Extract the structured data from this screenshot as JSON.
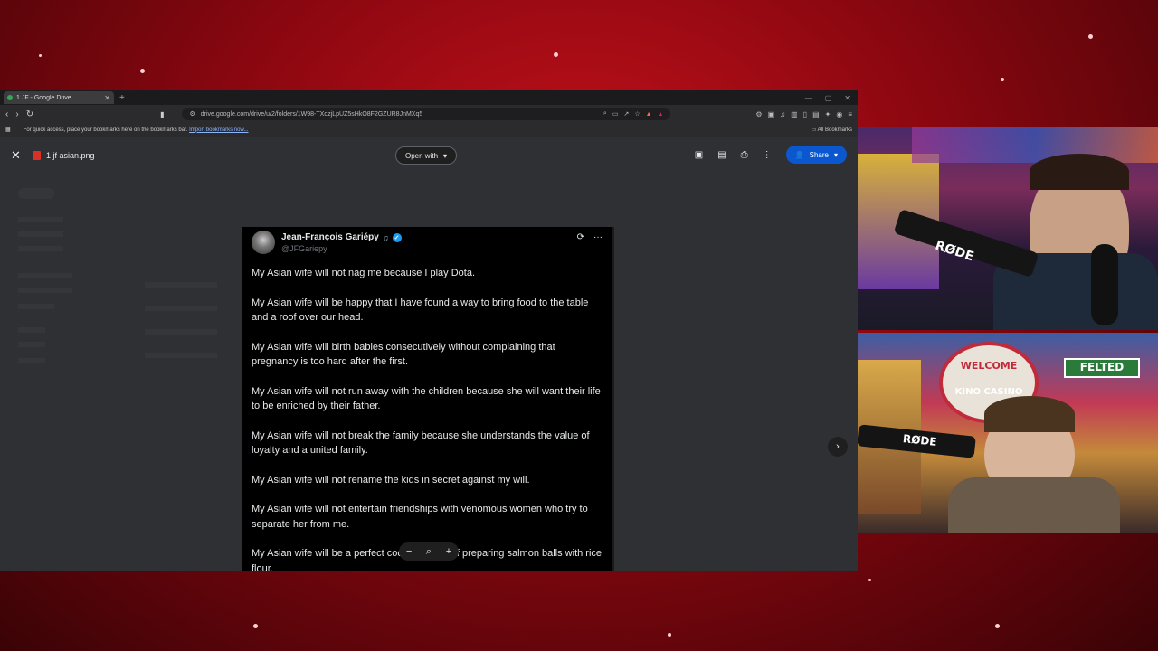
{
  "browser": {
    "tab_title": "1 JF - Google Drive",
    "url": "drive.google.com/drive/u/2/folders/1W98-TXqzjLpUZ5sHkO8F2GZUR8JnMXq5",
    "bookmarks_hint": "For quick access, place your bookmarks here on the bookmarks bar.",
    "import_bookmarks_link": "Import bookmarks now...",
    "all_bookmarks": "All Bookmarks"
  },
  "viewer": {
    "file_name": "1 jf asian.png",
    "open_with_label": "Open with",
    "share_label": "Share",
    "zoom_out": "−",
    "zoom_icon": "⌕",
    "zoom_in": "+"
  },
  "tweet": {
    "author_name": "Jean-François Gariépy",
    "handle": "@JFGariepy",
    "paragraphs": [
      "My Asian wife will not nag me because I play Dota.",
      "My Asian wife will be happy that I have found a way to bring food to the table and a roof over our head.",
      "My Asian wife will birth babies consecutively without complaining that pregnancy is too hard after the first.",
      "My Asian wife will not run away with the children because she will want their life to be enriched by their father.",
      "My Asian wife will not break the family because she understands the value of loyalty and a united family.",
      "My Asian wife will not rename the kids in secret against my will.",
      "My Asian wife will not entertain friendships with venomous women who try to separate her from me.",
      "My Asian wife will be a perfect cook, capable of preparing salmon balls with rice flour."
    ]
  },
  "cams": {
    "cam1_mic_label": "RØDE",
    "cam2_mic_label": "RØDE",
    "welcome_sign": "WELCOME",
    "casino_sign": "KINO CASINO",
    "street_sign": "FELTED"
  },
  "colors": {
    "share_button": "#0b57d0",
    "verified_badge": "#1d9bf0",
    "background_red": "#c4111a"
  }
}
